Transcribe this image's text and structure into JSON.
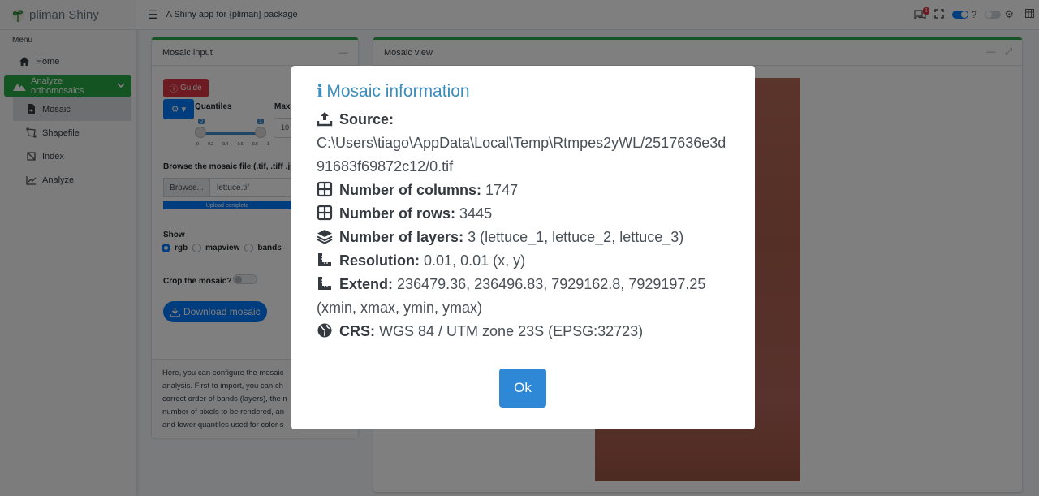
{
  "app": {
    "brand": "pliman Shiny",
    "title": "A Shiny app for {pliman} package",
    "notification_count": "2"
  },
  "sidebar": {
    "menu_header": "Menu",
    "home": "Home",
    "analyze_orthomosaics": "Analyze orthomosaics",
    "sub_items": [
      "Mosaic",
      "Shapefile",
      "Index",
      "Analyze"
    ]
  },
  "left_card": {
    "title": "Mosaic input",
    "guide_label": "Guide",
    "quantiles_label": "Quantiles",
    "max_label": "Max",
    "max_value": "10",
    "slider_min_tag": "0",
    "slider_max_tag": "1",
    "slider_ticks": [
      "0",
      "0.2",
      "0.4",
      "0.6",
      "0.8",
      "1"
    ],
    "browse_label": "Browse the mosaic file (.tif, .tiff .jp",
    "browse_button": "Browse...",
    "file_name": "lettuce.tif",
    "upload_status": "Upload complete",
    "upload_progress": 1.0,
    "show_label": "Show",
    "show_options": [
      "rgb",
      "mapview",
      "bands"
    ],
    "show_selected": "rgb",
    "crop_label": "Crop the mosaic?",
    "download_label": "Download mosaic",
    "footer_lines": [
      "Here, you can configure the mosaic",
      "analysis. First to import, you can ch",
      "correct order of bands (layers), the n",
      "number of pixels to be rendered, an",
      "and lower quantiles used for color s"
    ]
  },
  "right_card": {
    "title": "Mosaic view"
  },
  "modal": {
    "title": "Mosaic information",
    "source_label": "Source:",
    "source_value": "C:\\Users\\tiago\\AppData\\Local\\Temp\\Rtmpes2yWL/2517636e3d91683f69872c12/0.tif",
    "columns_label": "Number of columns:",
    "columns_value": "1747",
    "rows_label": "Number of rows:",
    "rows_value": "3445",
    "layers_label": "Number of layers:",
    "layers_value": "3 (lettuce_1, lettuce_2, lettuce_3)",
    "resolution_label": "Resolution:",
    "resolution_value": "0.01, 0.01 (x, y)",
    "extend_label": "Extend:",
    "extend_value": "236479.36, 236496.83, 7929162.8, 7929197.25 (xmin, xmax, ymin, ymax)",
    "crs_label": "CRS:",
    "crs_value": "WGS 84 / UTM zone 23S (EPSG:32723)",
    "ok_label": "Ok"
  },
  "colors": {
    "accent": "#28a745",
    "primary": "#007bff",
    "danger": "#dc3545",
    "title_blue": "#3c8dbc"
  }
}
